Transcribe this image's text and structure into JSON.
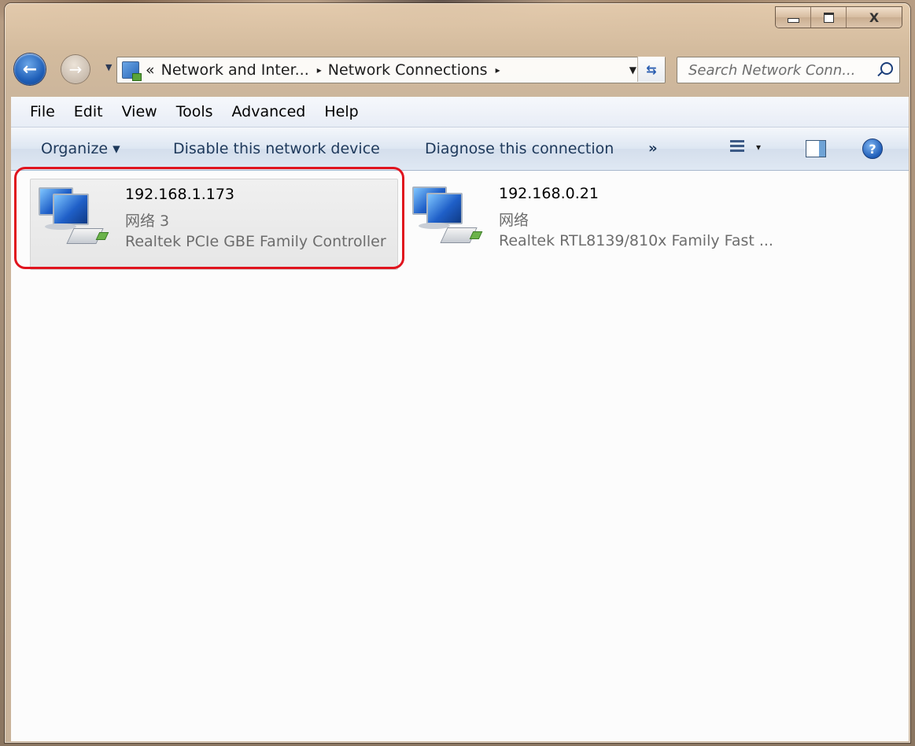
{
  "window": {
    "controls": {
      "minimize": "",
      "maximize": "",
      "close": "X"
    }
  },
  "address_bar": {
    "overflow": "«",
    "crumbs": [
      "Network and Inter...",
      "Network Connections"
    ],
    "separator": "▸"
  },
  "search": {
    "placeholder": "Search Network Conn..."
  },
  "menu": [
    "File",
    "Edit",
    "View",
    "Tools",
    "Advanced",
    "Help"
  ],
  "commands": {
    "organize": "Organize ▾",
    "disable": "Disable this network device",
    "diagnose": "Diagnose this connection",
    "more": "»",
    "views_drop": "▾",
    "help": "?"
  },
  "connections": [
    {
      "title": "192.168.1.173",
      "network": "网络 3",
      "device": "Realtek PCIe GBE Family Controller",
      "selected": true
    },
    {
      "title": "192.168.0.21",
      "network": "网络",
      "device": "Realtek RTL8139/810x Family Fast ...",
      "selected": false
    }
  ],
  "colors": {
    "highlight": "#e0141e",
    "command_text": "#1e395b",
    "secondary_text": "#6d6d6d"
  },
  "icons": [
    "back-arrow-icon",
    "forward-arrow-icon",
    "network-folder-icon",
    "refresh-icon",
    "search-icon",
    "views-icon",
    "preview-pane-icon",
    "help-icon",
    "network-connection-icon"
  ]
}
